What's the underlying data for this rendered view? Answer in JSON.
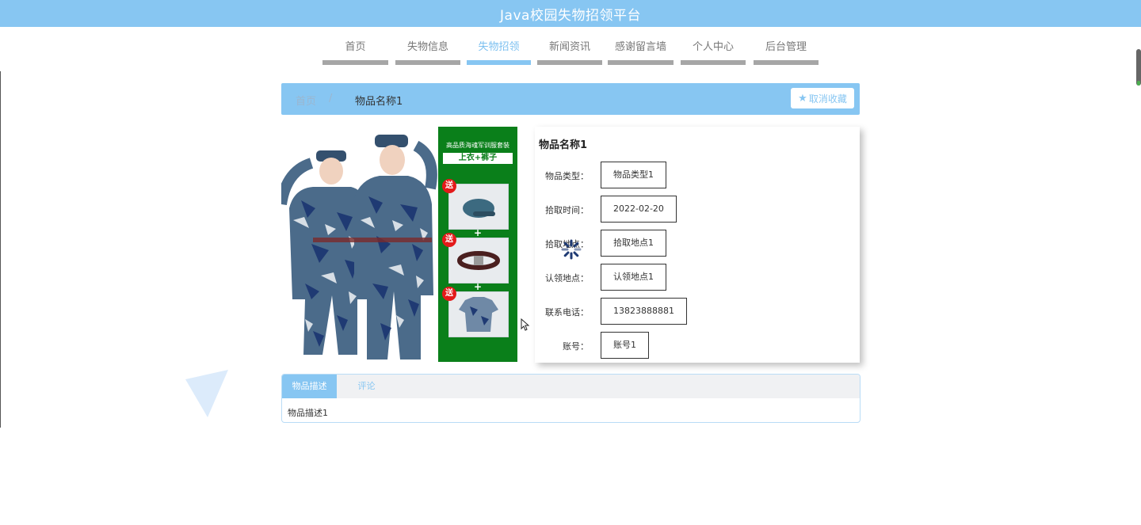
{
  "header": {
    "title": "Java校园失物招领平台"
  },
  "nav": {
    "items": [
      {
        "label": "首页"
      },
      {
        "label": "失物信息"
      },
      {
        "label": "失物招领",
        "active": true
      },
      {
        "label": "新闻资讯"
      },
      {
        "label": "感谢留言墙"
      },
      {
        "label": "个人中心"
      },
      {
        "label": "后台管理"
      }
    ]
  },
  "breadcrumb": {
    "home": "首页",
    "separator": "/",
    "current": "物品名称1"
  },
  "favorite_button": {
    "label": "取消收藏",
    "icon": "star-icon"
  },
  "product_image": {
    "promo_title": "高品质海魂军训服套装",
    "promo_subtitle": "上衣+裤子",
    "badge": "送",
    "plus": "+"
  },
  "detail": {
    "title": "物品名称1",
    "fields": [
      {
        "label": "物品类型：",
        "value": "物品类型1"
      },
      {
        "label": "拾取时间：",
        "value": "2022-02-20"
      },
      {
        "label": "拾取地点：",
        "value": "拾取地点1"
      },
      {
        "label": "认领地点：",
        "value": "认领地点1"
      },
      {
        "label": "联系电话：",
        "value": "13823888881"
      },
      {
        "label": "账号：",
        "value": "账号1"
      }
    ]
  },
  "tabs": {
    "items": [
      {
        "label": "物品描述",
        "active": true
      },
      {
        "label": "评论",
        "active": false
      }
    ],
    "content": "物品描述1"
  },
  "colors": {
    "accent": "#87c6f2",
    "nav_bar": "#a6a6a6",
    "promo_green": "#0a7f1a",
    "badge_red": "#e31a1a"
  }
}
